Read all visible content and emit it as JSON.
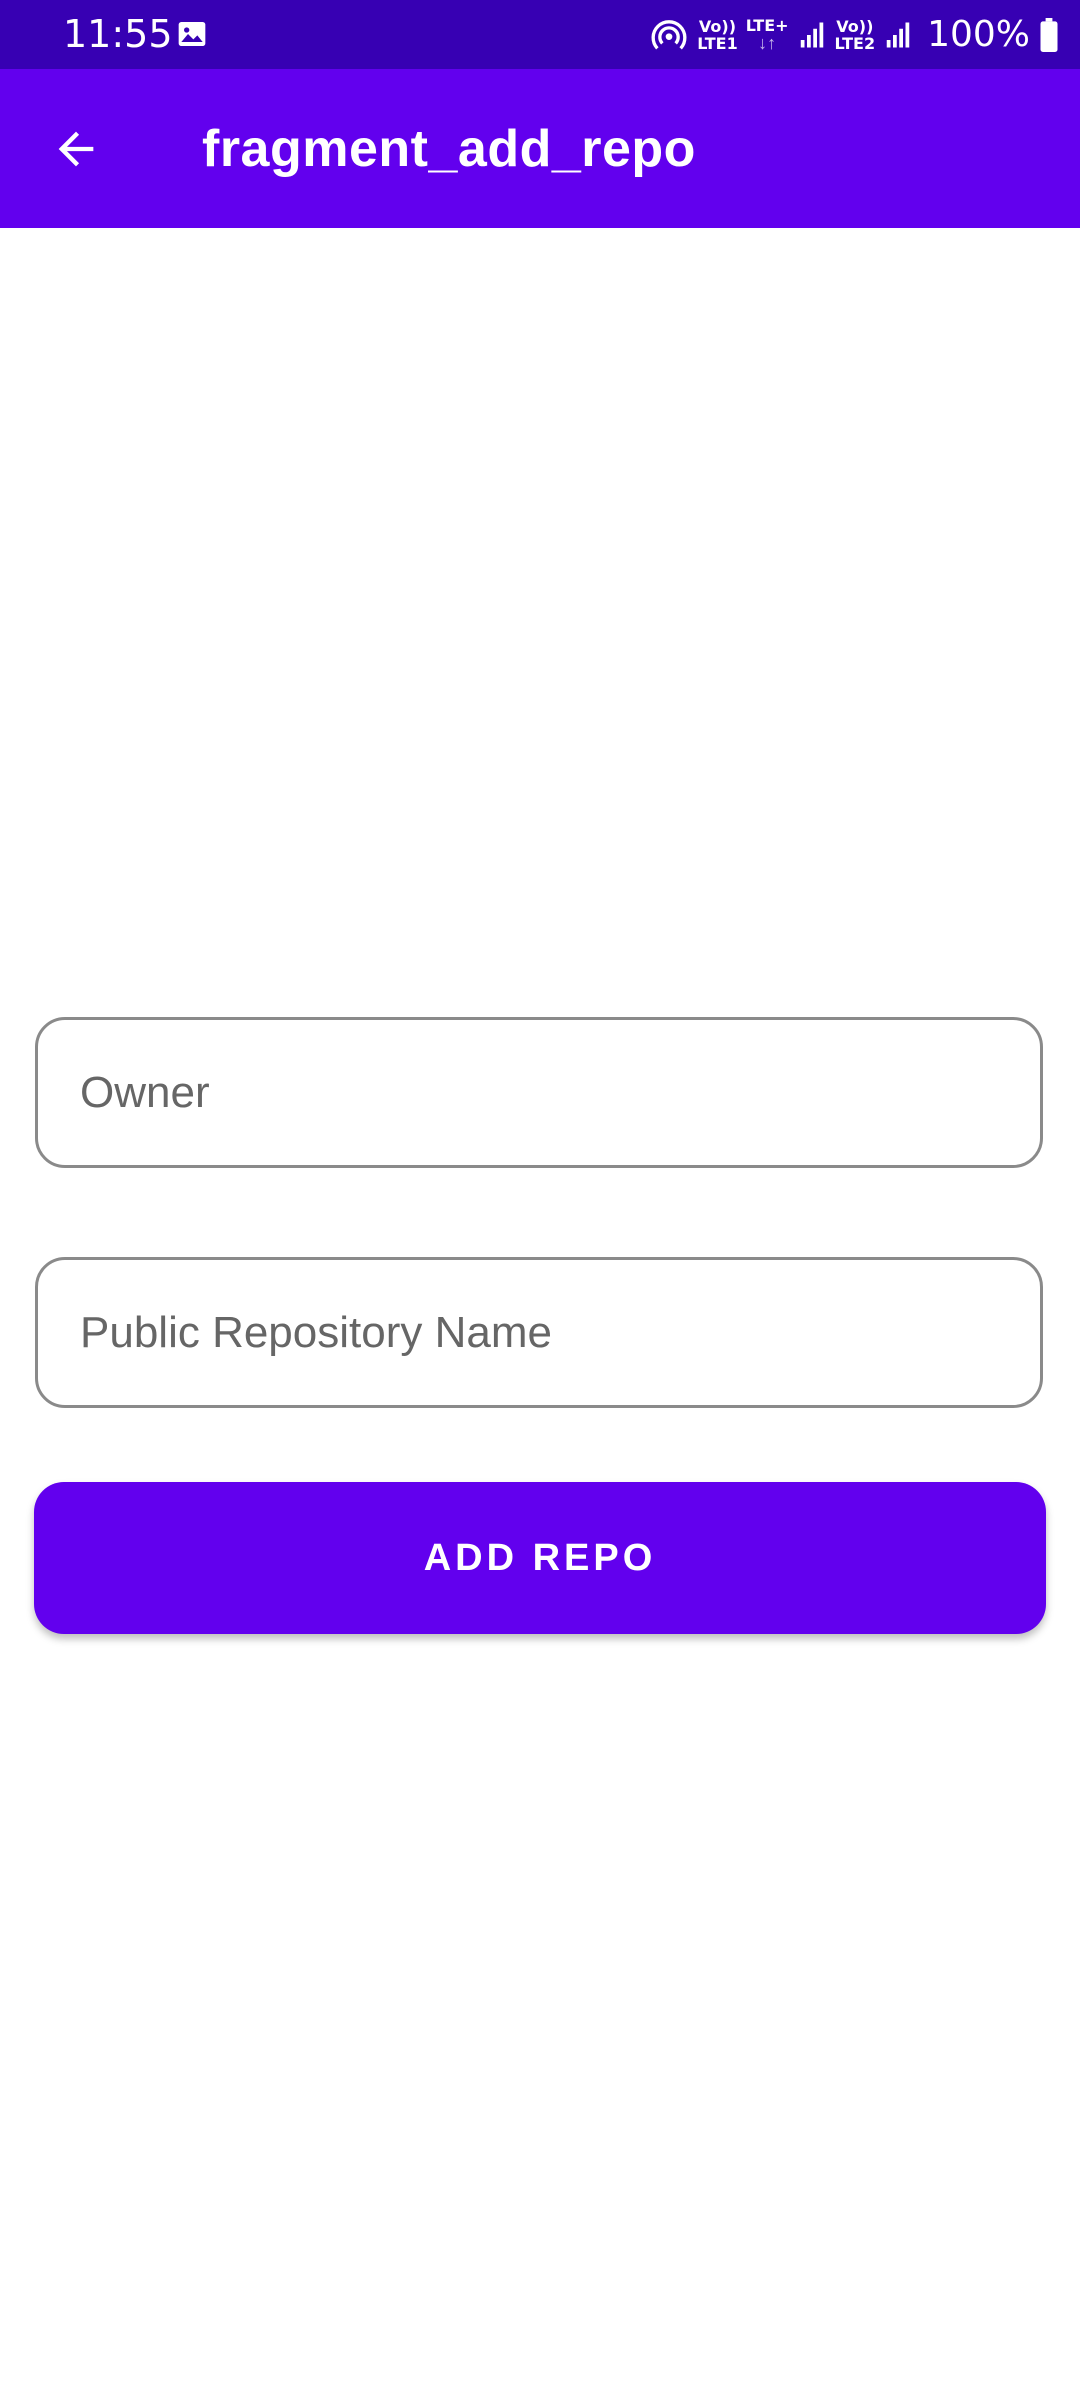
{
  "status_bar": {
    "time": "11:55",
    "gallery_icon": "image-icon",
    "hotspot_icon": "hotspot-icon",
    "sim1": {
      "top": "Vo))",
      "bottom": "LTE1"
    },
    "lte_plus": "LTE+",
    "data_arrows": "↓↑",
    "sim2": {
      "top": "Vo))",
      "bottom": "LTE2"
    },
    "battery": "100%",
    "colors": {
      "background": "#3700B3",
      "foreground": "#FFFFFF"
    }
  },
  "app_bar": {
    "back_icon": "arrow-back-icon",
    "title": "fragment_add_repo",
    "color": "#6200EE"
  },
  "form": {
    "owner": {
      "placeholder": "Owner",
      "value": ""
    },
    "repo": {
      "placeholder": "Public Repository Name",
      "value": ""
    },
    "add_button_label": "ADD REPO"
  }
}
